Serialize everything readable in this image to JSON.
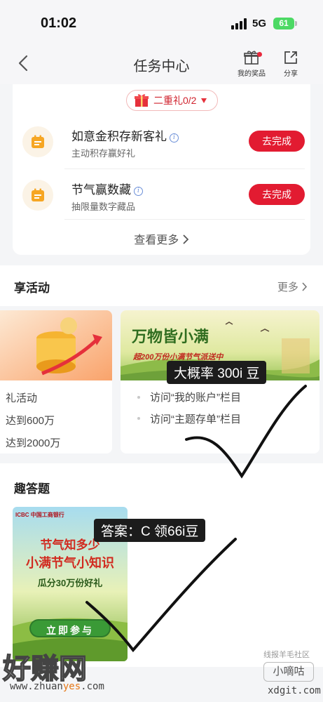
{
  "status_bar": {
    "time": "01:02",
    "network": "5G",
    "battery": "61"
  },
  "nav": {
    "title": "任务中心",
    "prizes_label": "我的奖品",
    "share_label": "分享"
  },
  "tasks_card": {
    "gift_pill": "二重礼0/2",
    "tasks": [
      {
        "name": "如意金积存新客礼",
        "desc": "主动积存赢好礼",
        "button": "去完成"
      },
      {
        "name": "节气赢数藏",
        "desc": "抽限量数字藏品",
        "button": "去完成"
      }
    ],
    "see_more": "查看更多"
  },
  "activities": {
    "title": "享活动",
    "more": "更多",
    "left_card": {
      "lines": [
        "礼活动",
        "达到600万",
        "达到2000万"
      ]
    },
    "right_card": {
      "banner_title": "万物皆小满",
      "banner_sub": "超200万份小满节气派送中",
      "lines": [
        "访问“我的账户”栏目",
        "访问“主题存单”栏目"
      ]
    }
  },
  "quiz": {
    "title": "趣答题",
    "poster": {
      "bank": "ICBC 中国工商银行",
      "line1": "节气知多少",
      "line2": "小满节气小知识",
      "line3": "瓜分30万份好礼",
      "cta": "立即参与"
    }
  },
  "annotations": {
    "label1": "大概率 300i 豆",
    "label2": "答案：C  领66i豆"
  },
  "watermark": {
    "left_big": "好赚网",
    "left_url_a": "www.zhuan",
    "left_url_b": "yes",
    "left_url_c": ".com",
    "right_small": "线报羊毛社区",
    "right_box": "小嘀咕",
    "right_url": "xdgit.com"
  }
}
